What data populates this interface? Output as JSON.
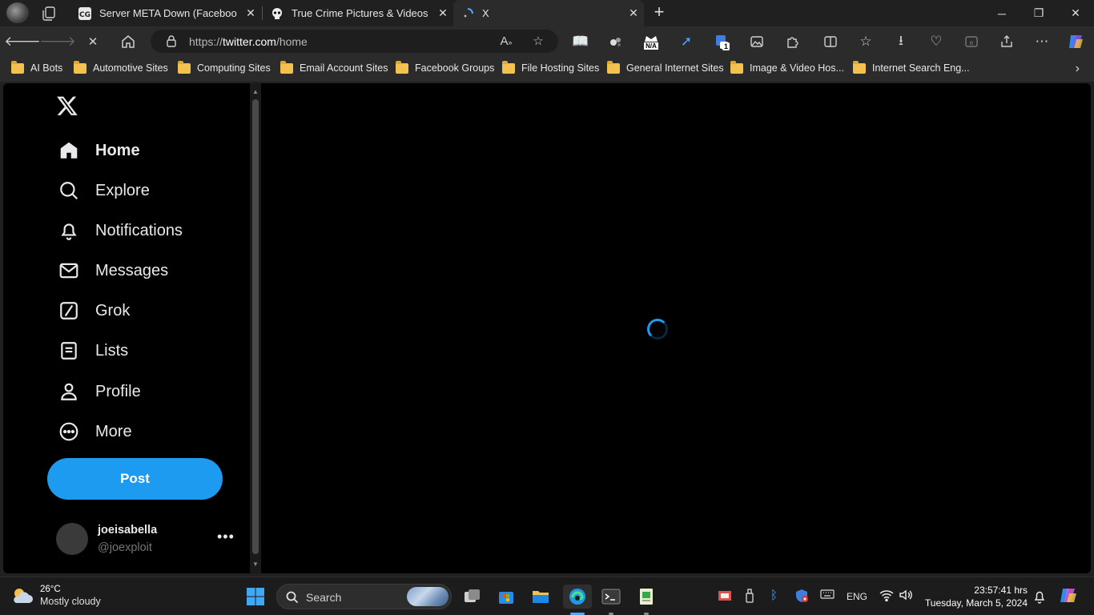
{
  "browser": {
    "tabs": [
      {
        "title": "Server META Down (Facebook &",
        "favicon": "cg-icon"
      },
      {
        "title": "True Crime Pictures & Videos Do",
        "favicon": "skull-icon"
      },
      {
        "title": "X",
        "favicon": "loading-icon"
      }
    ],
    "url_prefix": "https://",
    "url_host": "twitter.com",
    "url_path": "/home",
    "bookmarks": [
      "AI Bots",
      "Automotive Sites",
      "Computing Sites",
      "Email Account Sites",
      "Facebook Groups",
      "File Hosting Sites",
      "General Internet Sites",
      "Image & Video Hos...",
      "Internet Search Eng..."
    ],
    "extension_badge": "1",
    "extension_na_label": "N/A"
  },
  "sidebar": {
    "items": [
      {
        "label": "Home",
        "icon": "home-icon"
      },
      {
        "label": "Explore",
        "icon": "search-icon"
      },
      {
        "label": "Notifications",
        "icon": "bell-icon"
      },
      {
        "label": "Messages",
        "icon": "envelope-icon"
      },
      {
        "label": "Grok",
        "icon": "grok-icon"
      },
      {
        "label": "Lists",
        "icon": "list-icon"
      },
      {
        "label": "Profile",
        "icon": "person-icon"
      },
      {
        "label": "More",
        "icon": "more-circle-icon"
      }
    ],
    "post_label": "Post",
    "account": {
      "name": "joeisabella",
      "handle": "@joexploit"
    }
  },
  "taskbar": {
    "weather_temp": "26°C",
    "weather_condition": "Mostly cloudy",
    "search_label": "Search",
    "language": "ENG",
    "time": "23:57:41 hrs",
    "date": "Tuesday, March 5, 2024"
  },
  "colors": {
    "accent": "#1d9bf0",
    "page_bg": "#000000",
    "chrome_bg": "#2b2b2b"
  }
}
